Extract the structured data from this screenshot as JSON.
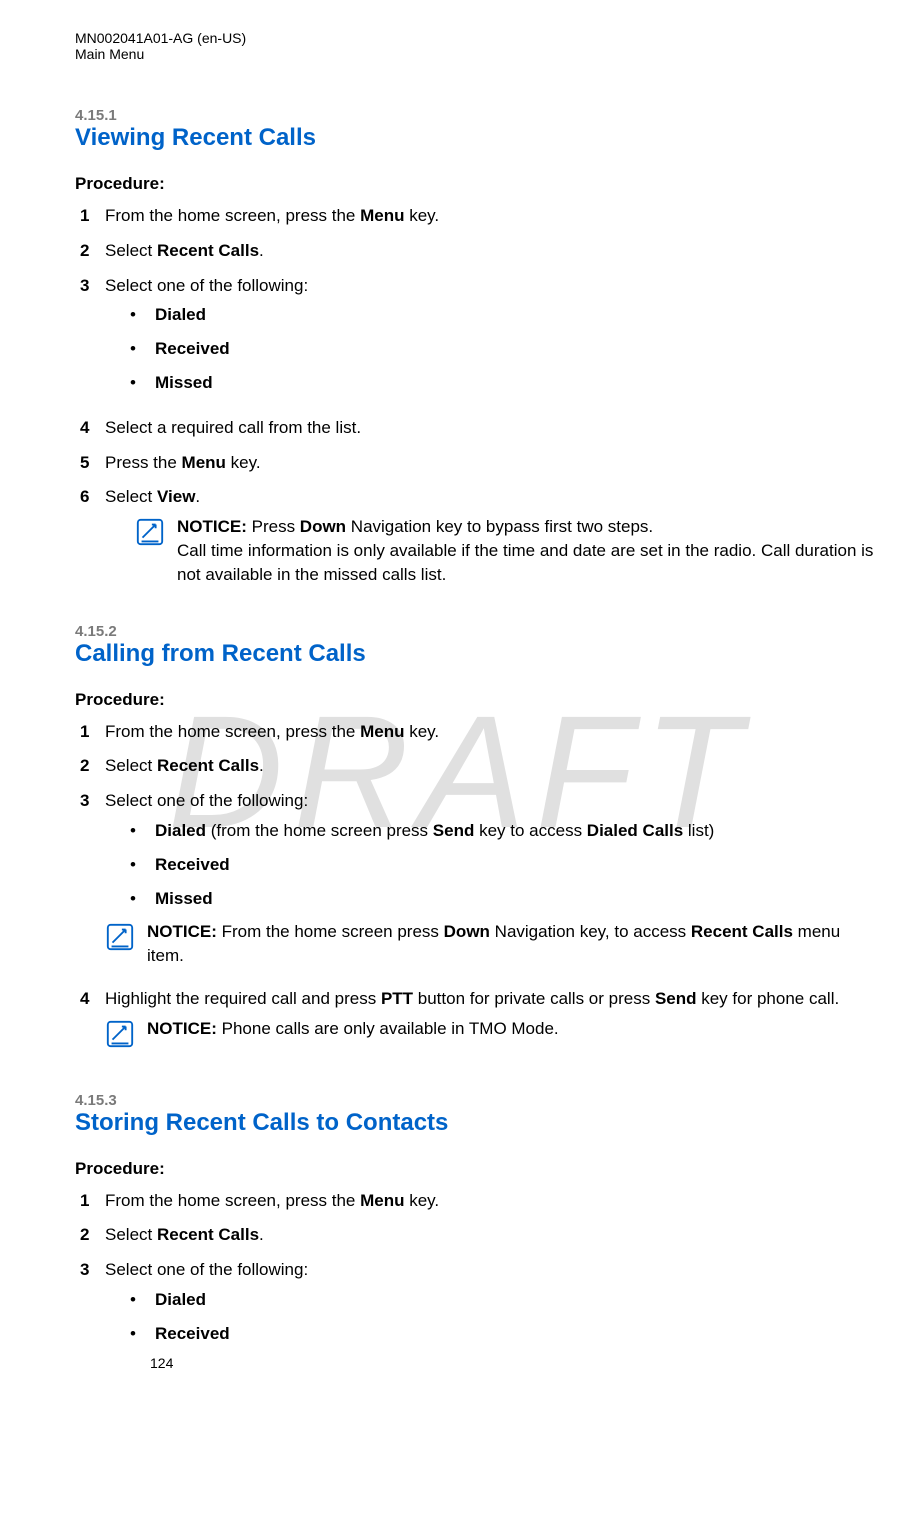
{
  "header": {
    "doc_id": "MN002041A01-AG (en-US)",
    "section": "Main Menu"
  },
  "watermark": "DRAFT",
  "sections": [
    {
      "num": "4.15.1",
      "title": "Viewing Recent Calls",
      "procedure_label": "Procedure:",
      "steps": [
        {
          "num": "1",
          "text_prefix": "From the home screen, press the ",
          "bold1": "Menu",
          "text_suffix": " key."
        },
        {
          "num": "2",
          "text_prefix": "Select ",
          "bold1": "Recent Calls",
          "text_suffix": "."
        },
        {
          "num": "3",
          "text_prefix": "Select one of the following:",
          "bullets": [
            {
              "bold": "Dialed"
            },
            {
              "bold": "Received"
            },
            {
              "bold": "Missed"
            }
          ]
        },
        {
          "num": "4",
          "text_prefix": "Select a required call from the list."
        },
        {
          "num": "5",
          "text_prefix": "Press the ",
          "bold1": "Menu",
          "text_suffix": " key."
        },
        {
          "num": "6",
          "text_prefix": "Select ",
          "bold1": "View",
          "text_suffix": ".",
          "notice": {
            "label": "NOTICE:",
            "text_a": " Press ",
            "bold_a": "Down",
            "text_b": " Navigation key to bypass first two steps.",
            "text_c": "Call time information is only available if the time and date are set in the radio. Call duration is not available in the missed calls list."
          }
        }
      ]
    },
    {
      "num": "4.15.2",
      "title": "Calling from Recent Calls",
      "procedure_label": "Procedure:",
      "steps": [
        {
          "num": "1",
          "text_prefix": "From the home screen, press the ",
          "bold1": "Menu",
          "text_suffix": " key."
        },
        {
          "num": "2",
          "text_prefix": "Select ",
          "bold1": "Recent Calls",
          "text_suffix": "."
        },
        {
          "num": "3",
          "text_prefix": "Select one of the following:",
          "bullets": [
            {
              "bold": "Dialed",
              "after_a": " (from the home screen press ",
              "after_bold": "Send",
              "after_b": " key to access ",
              "after_bold2": "Dialed Calls",
              "after_c": " list)"
            },
            {
              "bold": "Received"
            },
            {
              "bold": "Missed"
            }
          ],
          "notice": {
            "label": "NOTICE:",
            "text_a": " From the home screen press ",
            "bold_a": "Down",
            "text_b": " Navigation key, to access ",
            "bold_b": "Recent Calls",
            "text_c2": " menu item."
          }
        },
        {
          "num": "4",
          "text_prefix": "Highlight the required call and press ",
          "bold1": "PTT",
          "text_mid": " button for private calls or press ",
          "bold2": "Send",
          "text_suffix": " key for phone call.",
          "notice": {
            "label": "NOTICE:",
            "text_a": " Phone calls are only available in TMO Mode."
          }
        }
      ]
    },
    {
      "num": "4.15.3",
      "title": "Storing Recent Calls to Contacts",
      "procedure_label": "Procedure:",
      "steps": [
        {
          "num": "1",
          "text_prefix": "From the home screen, press the ",
          "bold1": "Menu",
          "text_suffix": " key."
        },
        {
          "num": "2",
          "text_prefix": "Select ",
          "bold1": "Recent Calls",
          "text_suffix": "."
        },
        {
          "num": "3",
          "text_prefix": "Select one of the following:",
          "bullets": [
            {
              "bold": "Dialed"
            },
            {
              "bold": "Received"
            }
          ]
        }
      ]
    }
  ],
  "page_num": "124"
}
